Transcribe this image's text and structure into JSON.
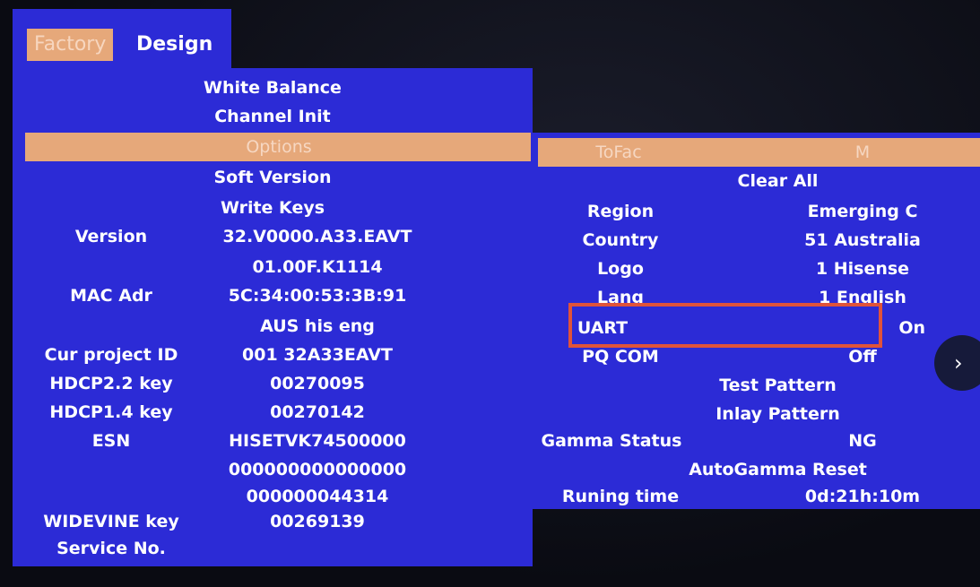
{
  "tabs": {
    "factory": "Factory",
    "design": "Design"
  },
  "menu": [
    "White Balance",
    "Channel Init",
    "Options",
    "Soft Version",
    "Write Keys"
  ],
  "info": {
    "version_label": "Version",
    "version_value_1": "32.V0000.A33.EAVT",
    "version_value_2": "01.00F.K1114",
    "mac_label": "MAC Adr",
    "mac_value": "5C:34:00:53:3B:91",
    "extra_value": "AUS his eng",
    "project_label": "Cur project ID",
    "project_value": "001 32A33EAVT",
    "hdcp22_label": "HDCP2.2 key",
    "hdcp22_value": "00270095",
    "hdcp14_label": "HDCP1.4 key",
    "hdcp14_value": "00270142",
    "esn_label": "ESN",
    "esn_value_1": "HISETVK74500000",
    "esn_value_2": "000000000000000",
    "esn_value_3": "000000044314",
    "widevine_label": "WIDEVINE key",
    "widevine_value": "00269139",
    "service_label": "Service No."
  },
  "options": {
    "tofac_label": "ToFac",
    "tofac_value": "M",
    "clear_all": "Clear All",
    "region_label": "Region",
    "region_value": "Emerging C",
    "country_label": "Country",
    "country_value": "51 Australia",
    "logo_label": "Logo",
    "logo_value": "1 Hisense",
    "lang_label": "Lang",
    "lang_value": "1 English",
    "uart_label": "UART",
    "uart_value": "On",
    "pqcom_label": "PQ COM",
    "pqcom_value": "Off",
    "test_pattern": "Test  Pattern",
    "inlay_pattern": "Inlay  Pattern",
    "gamma_label": "Gamma Status",
    "gamma_value": "NG",
    "autogamma": "AutoGamma Reset",
    "runtime_label": "Runing time",
    "runtime_value": "0d:21h:10m"
  },
  "nav": {
    "next_glyph": "›"
  },
  "colors": {
    "panel": "#2c2bd6",
    "highlight": "#e6a87a",
    "callout": "#e0533a"
  }
}
